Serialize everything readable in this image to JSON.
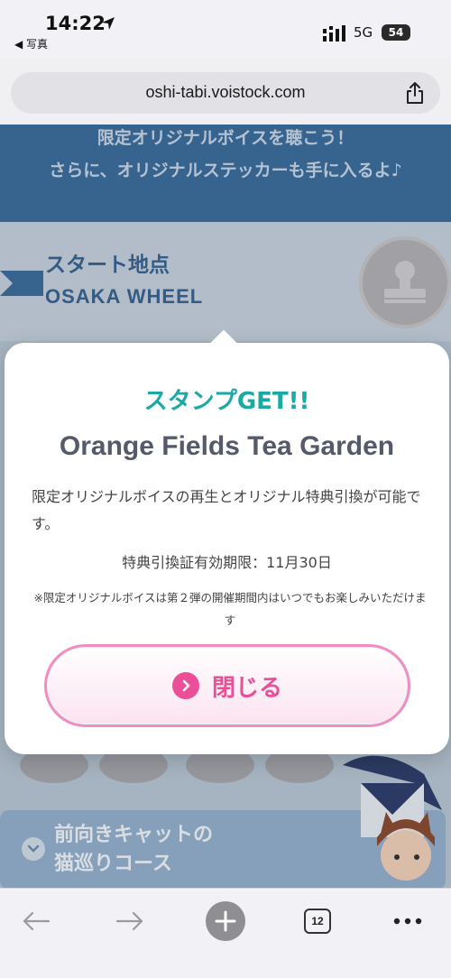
{
  "status_bar": {
    "time": "14:22",
    "back_app": "◀ 写真",
    "network": "5G",
    "battery": "54"
  },
  "browser": {
    "url": "oshi-tabi.voistock.com",
    "tab_count": "12"
  },
  "banner": {
    "line1": "限定オリジナルボイスを聴こう！",
    "line2": "さらに、オリジナルステッカーも手に入るよ♪"
  },
  "start": {
    "label": "スタート地点",
    "place": "OSAKA WHEEL"
  },
  "course": {
    "title_line1": "前向きキャットの",
    "title_line2": "猫巡りコース"
  },
  "modal": {
    "heading": "スタンプGET!!",
    "title": "Orange Fields Tea Garden",
    "body": "限定オリジナルボイスの再生とオリジナル特典引換が可能です。",
    "expiry": "特典引換証有効期限：11月30日",
    "note": "※限定オリジナルボイスは第２弾の開催期間内はいつでもお楽しみいただけます",
    "close_label": "閉じる"
  },
  "colors": {
    "accent_teal": "#1aa9a4",
    "accent_pink": "#ea4f98",
    "banner_blue": "#3a6d9c"
  }
}
